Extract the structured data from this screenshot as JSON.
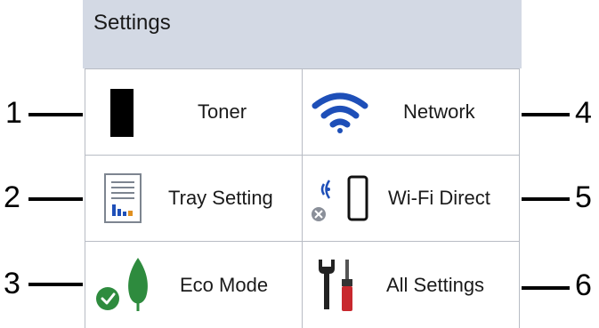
{
  "screen": {
    "title": "Settings"
  },
  "tiles": [
    {
      "label": "Toner",
      "icon": "toner-icon"
    },
    {
      "label": "Network",
      "icon": "wifi-icon"
    },
    {
      "label": "Tray Setting",
      "icon": "tray-setting-icon"
    },
    {
      "label": "Wi-Fi Direct",
      "icon": "wifi-direct-icon"
    },
    {
      "label": "Eco Mode",
      "icon": "eco-leaf-icon"
    },
    {
      "label": "All Settings",
      "icon": "tools-icon"
    }
  ],
  "callouts": [
    "1",
    "2",
    "3",
    "4",
    "5",
    "6"
  ],
  "colors": {
    "title_bar": "#d3d9e4",
    "wifi_blue": "#1e4fb8",
    "eco_green": "#2e8b3e",
    "tool_red": "#c8282e"
  }
}
